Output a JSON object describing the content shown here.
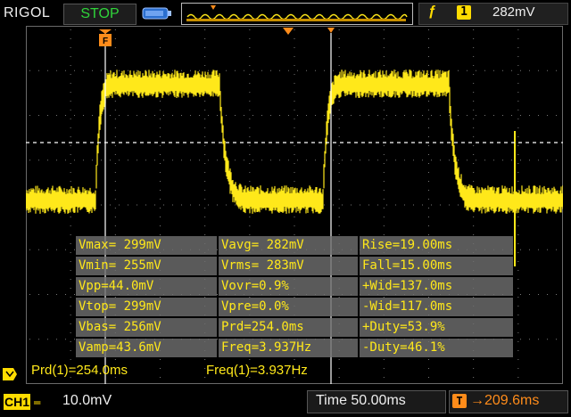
{
  "header": {
    "brand": "RIGOL",
    "run_state": "STOP",
    "trigger_edge_glyph": "ƒ",
    "trigger_source": "1",
    "trigger_level": "282mV"
  },
  "measurements": [
    [
      "Vmax= 299mV",
      "Vavg= 282mV",
      "Rise=19.00ms"
    ],
    [
      "Vmin= 255mV",
      "Vrms= 283mV",
      "Fall=15.00ms"
    ],
    [
      "Vpp=44.0mV",
      "Vovr=0.9%",
      "+Wid=137.0ms"
    ],
    [
      "Vtop= 299mV",
      "Vpre=0.0%",
      "-Wid=117.0ms"
    ],
    [
      "Vbas= 256mV",
      "Prd=254.0ms",
      "+Duty=53.9%"
    ],
    [
      "Vamp=43.6mV",
      "Freq=3.937Hz",
      "-Duty=46.1%"
    ]
  ],
  "cursor_readouts": {
    "prd": "Prd(1)=254.0ms",
    "freq": "Freq(1)=3.937Hz"
  },
  "status": {
    "channel": "CH1",
    "coupling_glyph": "═",
    "vertical_scale": "10.0mV",
    "timebase": "Time 50.00ms",
    "trigger_marker": "T",
    "horizontal_offset": "→209.6ms"
  },
  "waveform": {
    "color": "#ffe81a",
    "high_mV": 299,
    "low_mV": 255,
    "period_ms": 254.0
  },
  "colors": {
    "trace": "#ffe81a",
    "grid": "#777777",
    "run_state": "#2fd43a",
    "trigger": "#ff8c1a"
  }
}
